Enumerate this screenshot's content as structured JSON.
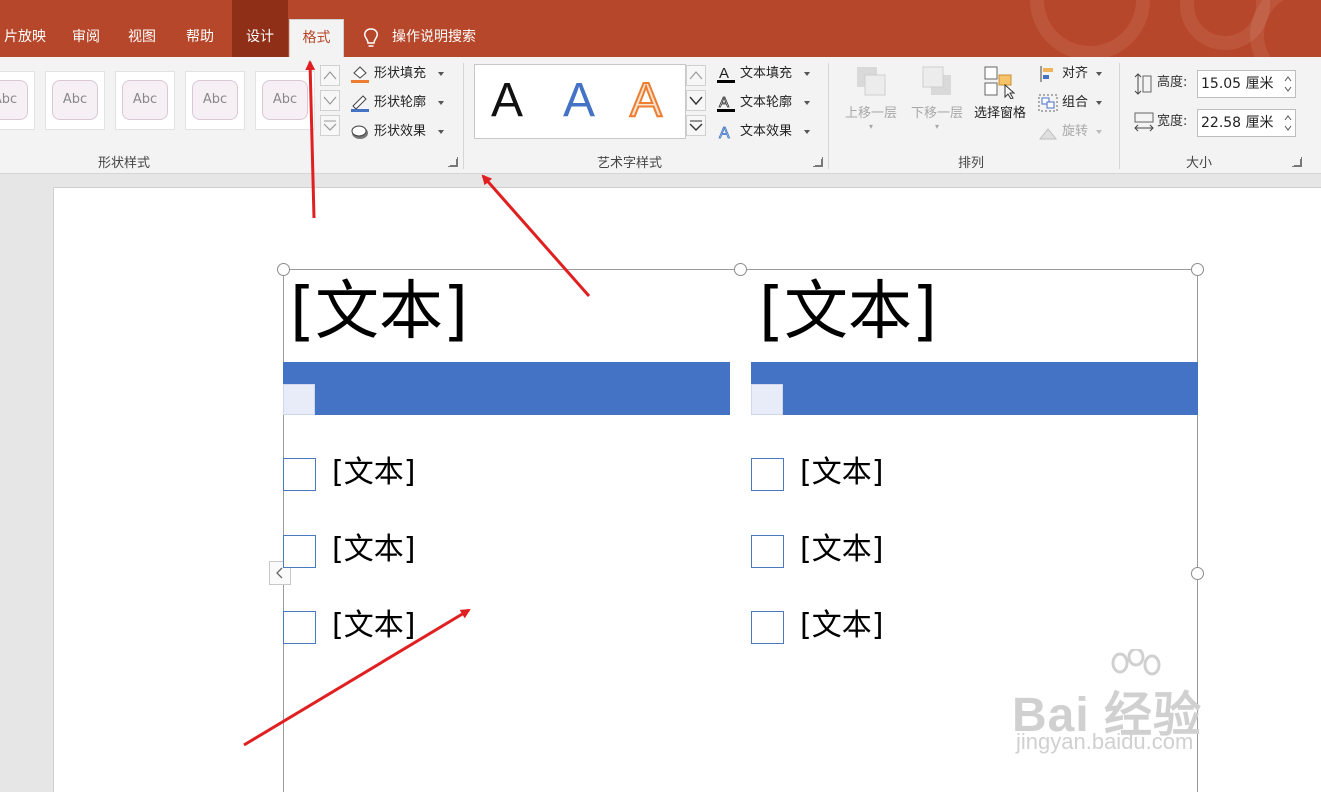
{
  "tabs": [
    {
      "label": "片放映"
    },
    {
      "label": "审阅"
    },
    {
      "label": "视图"
    },
    {
      "label": "帮助"
    },
    {
      "label": "设计"
    },
    {
      "label": "格式"
    }
  ],
  "tell_me": {
    "label": "操作说明搜索",
    "icon": "lightbulb-icon"
  },
  "shape_styles": {
    "group_label": "形状样式",
    "preset_label": "Abc",
    "fill_label": "形状填充",
    "outline_label": "形状轮廓",
    "effects_label": "形状效果"
  },
  "wordart_styles": {
    "group_label": "艺术字样式",
    "sample": "A",
    "text_fill_label": "文本填充",
    "text_outline_label": "文本轮廓",
    "text_effects_label": "文本效果"
  },
  "arrange": {
    "group_label": "排列",
    "bring_forward": "上移一层",
    "send_backward": "下移一层",
    "selection_pane": "选择窗格",
    "align": "对齐",
    "group": "组合",
    "rotate": "旋转"
  },
  "size": {
    "group_label": "大小",
    "height_label": "高度:",
    "height_value": "15.05 厘米",
    "width_label": "宽度:",
    "width_value": "22.58 厘米"
  },
  "slide": {
    "left_column": {
      "title": "[文本]",
      "items": [
        "[文本]",
        "[文本]",
        "[文本]"
      ]
    },
    "right_column": {
      "title": "[文本]",
      "items": [
        "[文本]",
        "[文本]",
        "[文本]"
      ]
    }
  },
  "watermark": {
    "main": "Bai 经验",
    "url": "jingyan.baidu.com"
  },
  "colors": {
    "title_bar": "#b7472a",
    "accent_bar": "#4472c4",
    "annotation_arrows": "#e02020"
  }
}
